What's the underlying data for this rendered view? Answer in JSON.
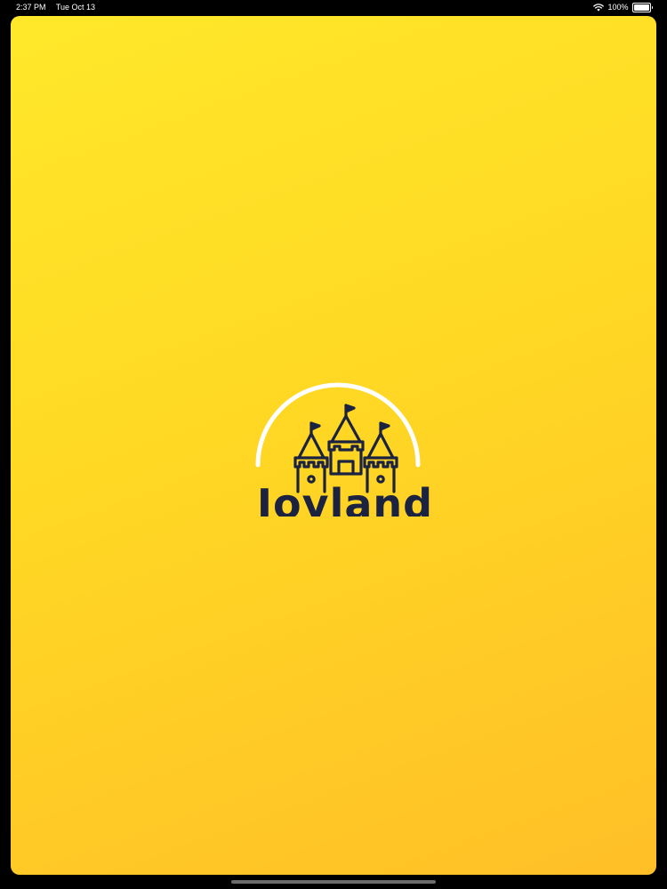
{
  "status_bar": {
    "time": "2:37 PM",
    "date": "Tue Oct 13",
    "battery_percent": "100%",
    "battery_level": 1.0
  },
  "splash": {
    "brand_name": "Joyland",
    "logo_icon": "castle-icon",
    "background_colors": [
      "#ffe82a",
      "#ffd824",
      "#ffbf27"
    ],
    "logo_color": "#1b2340",
    "arc_color": "#ffffff"
  }
}
